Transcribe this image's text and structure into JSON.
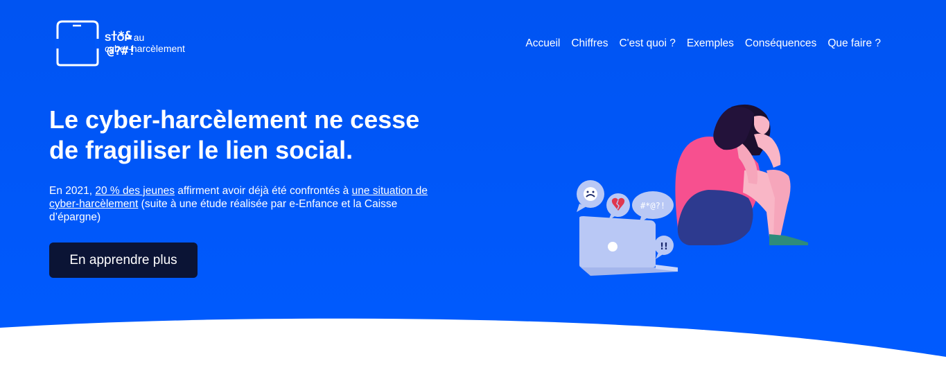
{
  "logo": {
    "symbols_line1": "!*&",
    "symbols_line2": "@?#!",
    "brand_strong": "STOP",
    "brand_rest": " au",
    "brand_line2": "cyber-harcèlement"
  },
  "nav": {
    "items": [
      "Accueil",
      "Chiffres",
      "C'est quoi ?",
      "Exemples",
      "Conséquences",
      "Que faire ?"
    ]
  },
  "hero": {
    "headline": "Le cyber-harcèlement ne cesse de fragiliser le lien social.",
    "sub_part1": "En 2021, ",
    "sub_link1": "20 % des jeunes",
    "sub_part2": " affirment avoir déjà été confrontés à ",
    "sub_link2": "une situation de cyber-harcèlement",
    "sub_part3": " (suite à une étude réalisée par e-Enfance et la Caisse d’épargne)",
    "cta_label": "En apprendre plus"
  },
  "illustration": {
    "bubble_text": "#*@?!",
    "bubble_small": "!!"
  },
  "colors": {
    "hero_bg": "#0057f8",
    "button_bg": "#0b1435",
    "pink": "#f7508f",
    "laptop": "#b9c8f5"
  }
}
